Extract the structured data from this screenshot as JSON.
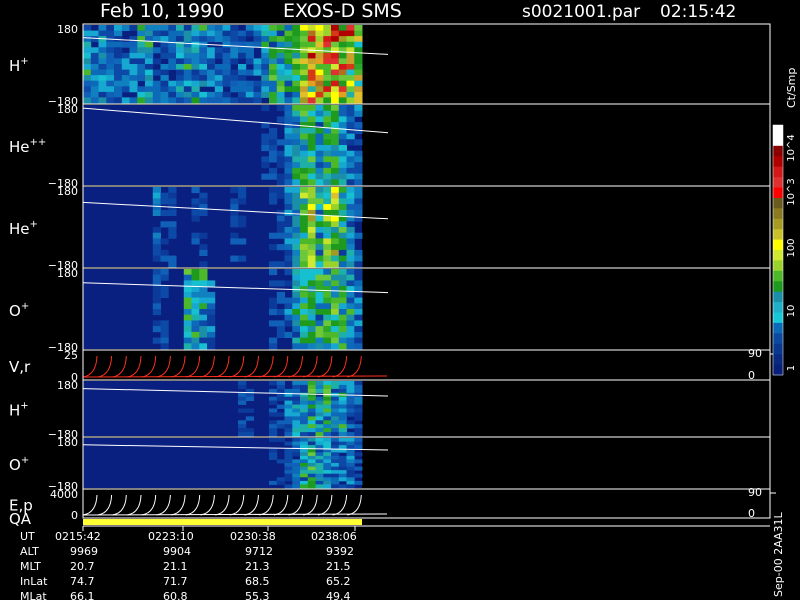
{
  "header": {
    "date": "Feb 10, 1990",
    "mission": "EXOS-D SMS",
    "file": "s0021001.par",
    "time": "02:15:42"
  },
  "colorbar": {
    "label": "Ct/Smp",
    "ticks": [
      "10^4",
      "10^3",
      "100",
      "10",
      "1"
    ],
    "colors": [
      "#ffffff",
      "#ffffff",
      "#8b0000",
      "#b00000",
      "#d41818",
      "#e03030",
      "#ff0000",
      "#6b5a1e",
      "#8a7a22",
      "#a59a22",
      "#c8c02a",
      "#ffff00",
      "#cfe830",
      "#9ad12a",
      "#4cb82a",
      "#1e9a1e",
      "#1c8fa8",
      "#1eb0c8",
      "#16c8d8",
      "#0d6ab8",
      "#0b4aa0",
      "#0a3790",
      "#0a2a80",
      "#08207a"
    ]
  },
  "chart_data": [
    {
      "type": "heatmap",
      "panel": "H",
      "label_main": "H",
      "label_sup": "+",
      "yticks": [
        "180",
        "−180"
      ],
      "ylim": [
        -180,
        180
      ],
      "activity": [
        3,
        2,
        3,
        2,
        2,
        2,
        2,
        3,
        3,
        2,
        2,
        2,
        3,
        3,
        3,
        3,
        2,
        2,
        2,
        2,
        2,
        2,
        2,
        3,
        4,
        4,
        4,
        5,
        7,
        9,
        8,
        9,
        10,
        9,
        8,
        7
      ],
      "line": {
        "start": 0.83,
        "end": 0.62
      }
    },
    {
      "type": "heatmap",
      "panel": "He2",
      "label_main": "He",
      "label_sup": "++",
      "yticks": [
        "180",
        "−180"
      ],
      "ylim": [
        -180,
        180
      ],
      "activity": [
        0,
        0,
        0,
        0,
        0,
        0,
        0,
        0,
        0,
        0,
        0,
        0,
        0,
        0,
        0,
        0,
        0,
        0,
        0,
        0,
        0,
        0,
        0,
        1,
        1,
        1,
        2,
        3,
        5,
        4,
        3,
        5,
        4,
        3,
        2,
        2
      ],
      "line": {
        "start": 0.95,
        "end": 0.65
      }
    },
    {
      "type": "heatmap",
      "panel": "He1",
      "label_main": "He",
      "label_sup": "+",
      "yticks": [
        "180",
        "−180"
      ],
      "ylim": [
        -180,
        180
      ],
      "activity": [
        0,
        0,
        0,
        0,
        0,
        0,
        0,
        0,
        0,
        2,
        1,
        1,
        0,
        0,
        1,
        1,
        0,
        0,
        0,
        1,
        1,
        0,
        0,
        0,
        1,
        1,
        2,
        3,
        6,
        8,
        4,
        6,
        7,
        4,
        3,
        2
      ],
      "line": {
        "start": 0.8,
        "end": 0.6
      }
    },
    {
      "type": "heatmap",
      "panel": "O1",
      "label_main": "O",
      "label_sup": "+",
      "yticks": [
        "180",
        "−180"
      ],
      "ylim": [
        -180,
        180
      ],
      "activity": [
        0,
        0,
        0,
        0,
        0,
        0,
        0,
        0,
        0,
        1,
        1,
        0,
        0,
        4,
        4,
        3,
        2,
        0,
        0,
        0,
        0,
        0,
        0,
        0,
        1,
        1,
        2,
        3,
        4,
        5,
        5,
        4,
        5,
        4,
        3,
        2
      ],
      "line": {
        "start": 0.82,
        "end": 0.7
      }
    },
    {
      "type": "line",
      "panel": "Vr",
      "label_main": "V,r",
      "label_sup": "",
      "yticks": [
        "25",
        "0"
      ],
      "ylim": [
        0,
        25
      ],
      "right_ticks": [
        "90",
        "0"
      ],
      "sawtooth_count": 19
    },
    {
      "type": "heatmap",
      "panel": "H2",
      "label_main": "H",
      "label_sup": "+",
      "yticks": [
        "180",
        "−180"
      ],
      "ylim": [
        -180,
        180
      ],
      "activity": [
        0,
        0,
        0,
        0,
        0,
        0,
        0,
        0,
        0,
        0,
        0,
        0,
        0,
        0,
        0,
        0,
        0,
        0,
        0,
        0,
        1,
        1,
        0,
        0,
        1,
        1,
        2,
        3,
        3,
        4,
        3,
        4,
        3,
        3,
        2,
        2
      ],
      "line": {
        "start": 0.85,
        "end": 0.72
      }
    },
    {
      "type": "heatmap",
      "panel": "O2",
      "label_main": "O",
      "label_sup": "+",
      "yticks": [
        "180",
        "−180"
      ],
      "ylim": [
        -180,
        180
      ],
      "activity": [
        0,
        0,
        0,
        0,
        0,
        0,
        0,
        0,
        0,
        0,
        0,
        0,
        0,
        0,
        0,
        0,
        0,
        0,
        0,
        0,
        0,
        0,
        0,
        0,
        1,
        1,
        1,
        2,
        3,
        4,
        3,
        3,
        2,
        2,
        2,
        1
      ],
      "line": {
        "start": 0.85,
        "end": 0.75
      }
    },
    {
      "type": "line",
      "panel": "Ep",
      "label_main": "E,p",
      "label_sup": "",
      "yticks": [
        "4000",
        "0"
      ],
      "ylim": [
        0,
        4000
      ],
      "right_ticks": [
        "90",
        "0"
      ],
      "sawtooth_count": 19
    }
  ],
  "qa": {
    "label": "QA",
    "color": "#ffff33"
  },
  "ephemeris": {
    "labels": [
      "UT",
      "ALT",
      "MLT",
      "InLat",
      "MLat"
    ],
    "columns": [
      [
        "0215:42",
        "9969",
        "20.7",
        "74.7",
        "66.1"
      ],
      [
        "0223:10",
        "9904",
        "21.1",
        "71.7",
        "60.8"
      ],
      [
        "0230:38",
        "9712",
        "21.3",
        "68.5",
        "55.3"
      ],
      [
        "0238:06",
        "9392",
        "21.5",
        "65.2",
        "49.4"
      ]
    ]
  },
  "footer_id": "Sep-00  2AA31L"
}
